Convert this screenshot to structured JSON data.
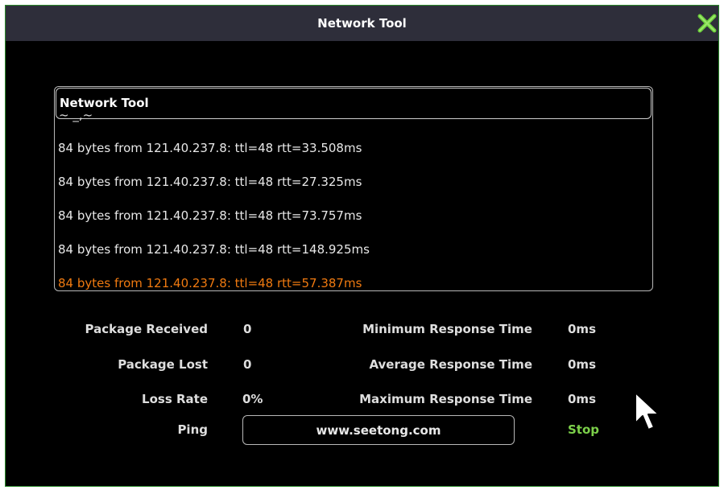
{
  "window": {
    "title": "Network Tool"
  },
  "log": {
    "header": "Network Tool",
    "lines": [
      "84 bytes from 121.40.237.8: ttl=48 rtt=33.508ms",
      "84 bytes from 121.40.237.8: ttl=48 rtt=27.325ms",
      "84 bytes from 121.40.237.8: ttl=48 rtt=73.757ms",
      "84 bytes from 121.40.237.8: ttl=48 rtt=148.925ms",
      "84 bytes from 121.40.237.8: ttl=48 rtt=57.387ms"
    ],
    "latest_color": "#f07a10"
  },
  "stats": {
    "package_received_label": "Package Received",
    "package_received_value": "0",
    "package_lost_label": "Package Lost",
    "package_lost_value": "0",
    "loss_rate_label": "Loss Rate",
    "loss_rate_value": "0%",
    "min_response_label": "Minimum Response Time",
    "min_response_value": "0ms",
    "avg_response_label": "Average Response Time",
    "avg_response_value": "0ms",
    "max_response_label": "Maximum Response Time",
    "max_response_value": "0ms"
  },
  "ping": {
    "label": "Ping",
    "host": "www.seetong.com",
    "stop_label": "Stop"
  },
  "icons": {
    "close": "close-x-icon",
    "cursor": "mouse-pointer-icon"
  },
  "colors": {
    "accent_green": "#7cd04a",
    "titlebar": "#2e2e3a",
    "highlight_orange": "#f07a10"
  }
}
